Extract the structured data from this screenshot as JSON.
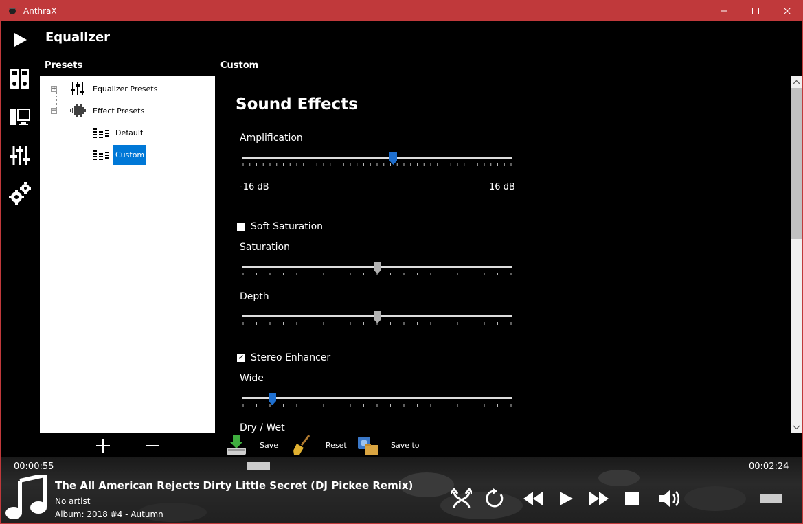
{
  "window": {
    "title": "AnthraX",
    "accent": "#c0393b"
  },
  "sidebar": {
    "items": [
      {
        "icon": "play-icon"
      },
      {
        "icon": "library-icon"
      },
      {
        "icon": "monitor-icon"
      },
      {
        "icon": "equalizer-sliders-icon"
      },
      {
        "icon": "settings-gears-icon"
      }
    ]
  },
  "page": {
    "title": "Equalizer"
  },
  "presets": {
    "label": "Presets",
    "tree": [
      {
        "label": "Equalizer Presets",
        "expanded": false
      },
      {
        "label": "Effect Presets",
        "expanded": true,
        "children": [
          {
            "label": "Default"
          },
          {
            "label": "Custom",
            "selected": true
          }
        ]
      }
    ]
  },
  "content": {
    "label": "Custom",
    "section_title": "Sound Effects",
    "amplification": {
      "label": "Amplification",
      "min_label": "-16 dB",
      "max_label": "16 dB",
      "value_fraction": 0.56
    },
    "soft_saturation": {
      "label": "Soft Saturation",
      "checked": false
    },
    "saturation": {
      "label": "Saturation",
      "value_fraction": 0.5
    },
    "depth": {
      "label": "Depth",
      "value_fraction": 0.5
    },
    "stereo_enhancer": {
      "label": "Stereo Enhancer",
      "checked": true
    },
    "wide": {
      "label": "Wide",
      "value_fraction": 0.11
    },
    "dry_wet": {
      "label": "Dry / Wet"
    }
  },
  "actions": {
    "save": "Save",
    "reset": "Reset",
    "save_to": "Save to"
  },
  "player": {
    "elapsed": "00:00:55",
    "total": "00:02:24",
    "artist_title": "The All American Rejects  Dirty Little Secret (DJ Pickee Remix)",
    "artist": "No artist",
    "album": "Album: 2018 #4 - Autumn",
    "controls": [
      "shuffle-icon",
      "repeat-icon",
      "rewind-icon",
      "play-icon",
      "fast-forward-icon",
      "stop-icon",
      "volume-icon"
    ]
  },
  "colors": {
    "selection": "#0078d7",
    "thumb_active": "#1e6fd0",
    "thumb_inactive": "#b0b0b0"
  }
}
